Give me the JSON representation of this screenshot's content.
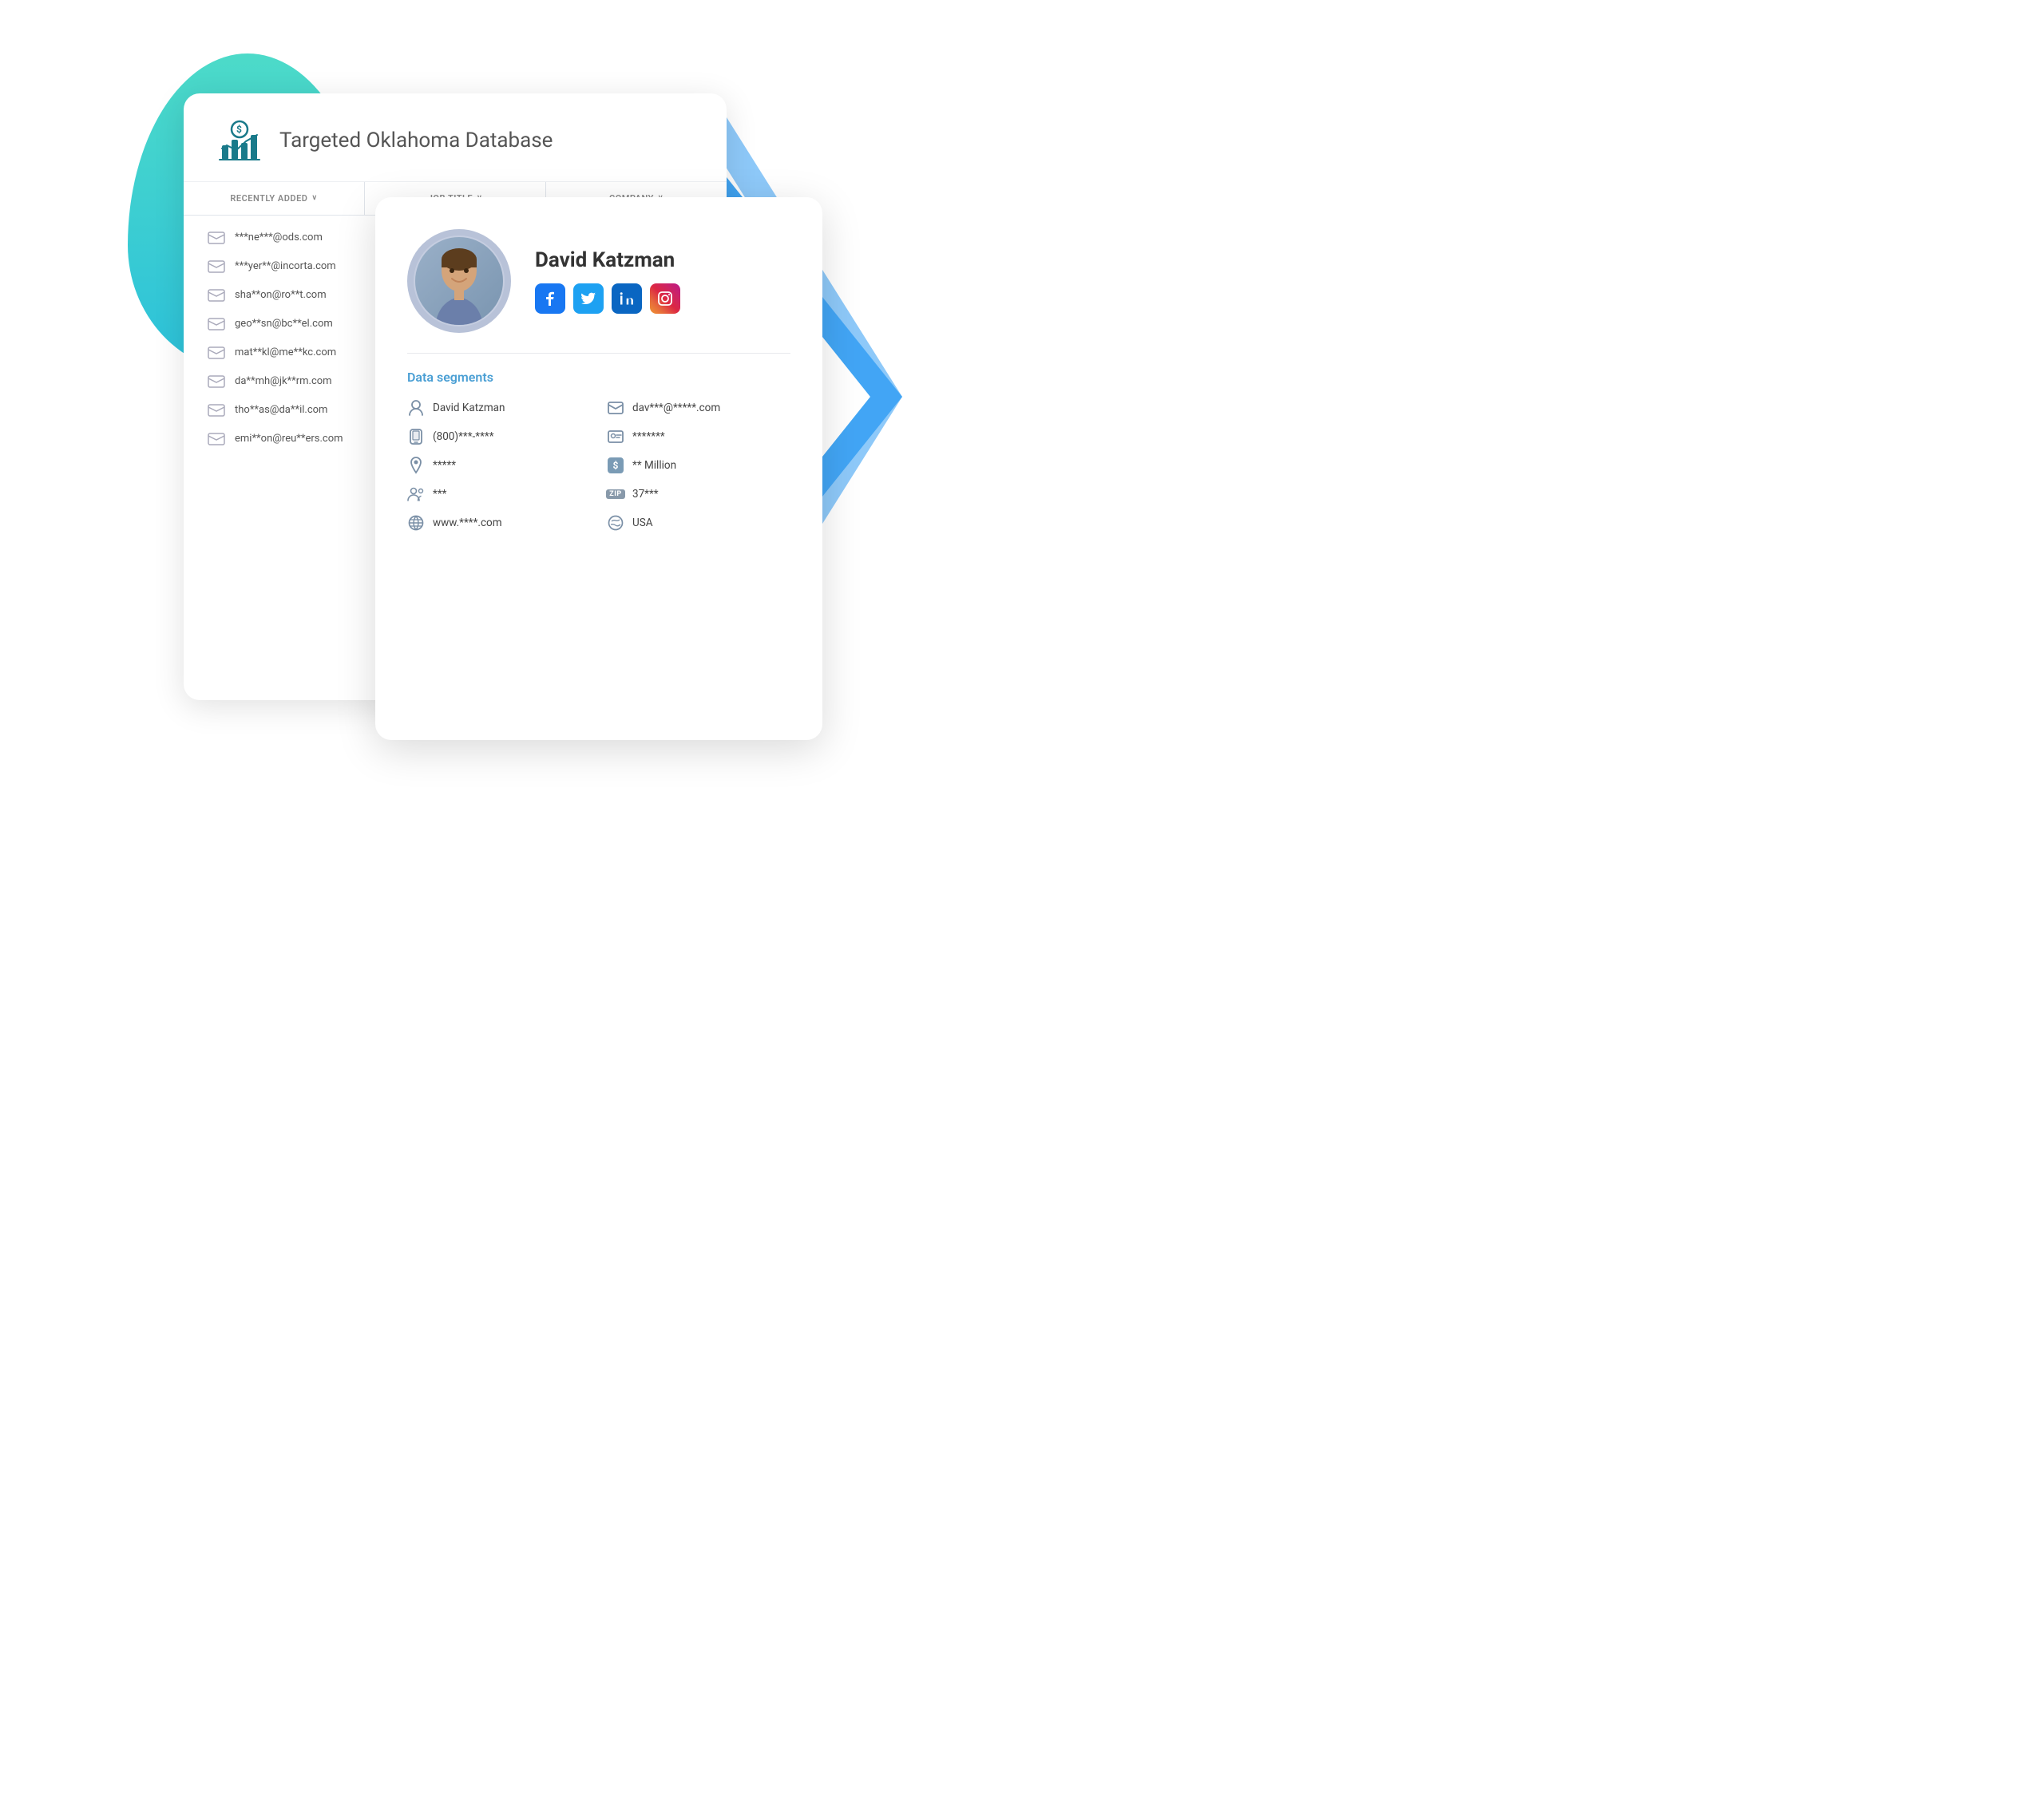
{
  "title": "Targeted Oklahoma Database",
  "logo": {
    "alt": "analytics-logo"
  },
  "filters": [
    {
      "label": "RECENTLY ADDED",
      "id": "recently-added"
    },
    {
      "label": "JOB TITLE",
      "id": "job-title"
    },
    {
      "label": "COMPANY",
      "id": "company"
    }
  ],
  "emails": [
    "***ne***@ods.com",
    "***yer**@incorta.com",
    "sha**on@ro**t.com",
    "geo**sn@bc**el.com",
    "mat**kl@me**kc.com",
    "da**mh@jk**rm.com",
    "tho**as@da**il.com",
    "emi**on@reu**ers.com"
  ],
  "profile": {
    "name": "David Katzman",
    "data_segments_label": "Data segments",
    "social": {
      "facebook": "f",
      "twitter": "t",
      "linkedin": "in",
      "instagram": "ig"
    },
    "segments": [
      {
        "icon": "person",
        "value": "David Katzman",
        "col": 1
      },
      {
        "icon": "email",
        "value": "dav***@*****.com",
        "col": 2
      },
      {
        "icon": "phone",
        "value": "(800)***-****",
        "col": 1
      },
      {
        "icon": "id-badge",
        "value": "*******",
        "col": 2
      },
      {
        "icon": "location",
        "value": "*****",
        "col": 1
      },
      {
        "icon": "dollar",
        "value": "** Million",
        "col": 2
      },
      {
        "icon": "people",
        "value": "***",
        "col": 1
      },
      {
        "icon": "zip",
        "value": "37***",
        "col": 2
      },
      {
        "icon": "globe",
        "value": "www.****.com",
        "col": 1
      },
      {
        "icon": "globe-flag",
        "value": "USA",
        "col": 2
      }
    ]
  }
}
